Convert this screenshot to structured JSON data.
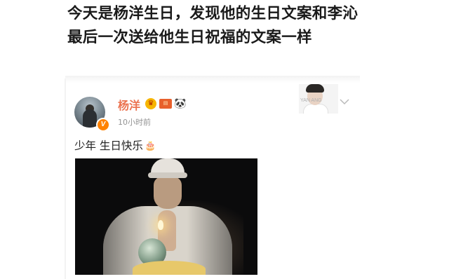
{
  "headline": {
    "line1": "今天是杨洋生日，发现他的生日文案和李沁",
    "line2": "最后一次送给他生日祝福的文案一样"
  },
  "post": {
    "username": "杨洋",
    "verified_badge": "V",
    "badges": [
      "crown-badge-icon",
      "vip-badge-icon",
      "panda-icon"
    ],
    "timestamp": "10小时前",
    "text": "少年 生日快乐",
    "text_emoji": "cake-emoji",
    "thumbnail_caption": "YAN      ANG",
    "accent_color": "#eb7350"
  }
}
